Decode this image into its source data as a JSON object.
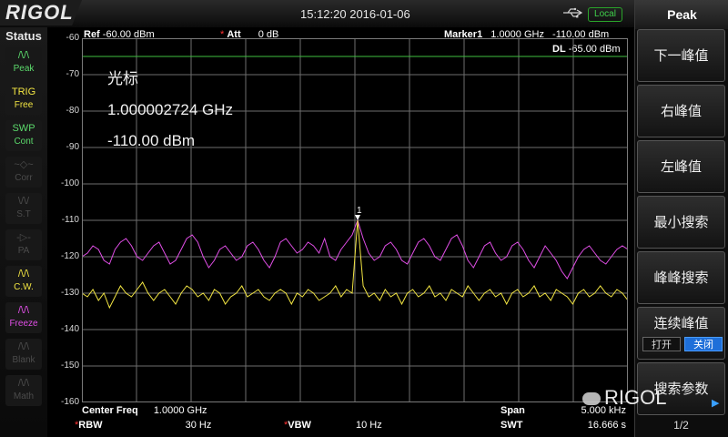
{
  "header": {
    "logo": "RIGOL",
    "datetime": "15:12:20 2016-01-06",
    "usb_icon": "usb-icon",
    "local_badge": "Local"
  },
  "status": {
    "title": "Status",
    "items": [
      {
        "glyph": "/\\/\\",
        "label": "Peak",
        "color": "#5bd96b"
      },
      {
        "glyph": "TRIG",
        "label": "Free",
        "color": "#f2e542"
      },
      {
        "glyph": "SWP",
        "label": "Cont",
        "color": "#5bd96b"
      },
      {
        "glyph": "~◇~",
        "label": "Corr",
        "color": "#4b4b4b"
      },
      {
        "glyph": "\\/\\/",
        "label": "S.T",
        "color": "#4b4b4b"
      },
      {
        "glyph": "-▷-",
        "label": "PA",
        "color": "#4b4b4b"
      },
      {
        "glyph": "/\\/\\",
        "label": "C.W.",
        "color": "#f2e542"
      },
      {
        "glyph": "/\\/\\",
        "label": "Freeze",
        "color": "#e04ee6"
      },
      {
        "glyph": "/\\/\\",
        "label": "Blank",
        "color": "#4b4b4b"
      },
      {
        "glyph": "/\\/\\",
        "label": "Math",
        "color": "#4b4b4b"
      }
    ]
  },
  "top_readouts": {
    "ref_label": "Ref",
    "ref_value": "-60.00 dBm",
    "att_label": "Att",
    "att_value": "0 dB",
    "marker_label": "Marker1",
    "marker_freq": "1.0000 GHz",
    "marker_amp": "-110.00 dBm",
    "dl_label": "DL",
    "dl_value": "-65.00 dBm"
  },
  "marker_box": {
    "title": "光标",
    "freq": "1.000002724 GHz",
    "amp": "-110.00 dBm",
    "marker_number": "1"
  },
  "bottom": {
    "center_label": "Center Freq",
    "center_value": "1.0000 GHz",
    "span_label": "Span",
    "span_value": "5.000 kHz",
    "rbw_label": "RBW",
    "rbw_value": "30 Hz",
    "vbw_label": "VBW",
    "vbw_value": "10 Hz",
    "swt_label": "SWT",
    "swt_value": "16.666 s"
  },
  "menu": {
    "title": "Peak",
    "keys": [
      "下一峰值",
      "右峰值",
      "左峰值",
      "最小搜索",
      "峰峰搜索",
      "连续峰值",
      "搜索参数"
    ],
    "toggle_on": "打开",
    "toggle_off": "关闭",
    "toggle_selected": "关闭",
    "page": "1/2"
  },
  "watermark": "RIGOL",
  "chart_data": {
    "type": "line",
    "ylim": [
      -160,
      -60
    ],
    "y_ticks": [
      "-60",
      "-70",
      "-80",
      "-90",
      "-100",
      "-110",
      "-120",
      "-130",
      "-140",
      "-150",
      "-160"
    ],
    "y_unit": "dBm",
    "display_line": -65,
    "x_center_ghz": 1.0,
    "x_span_khz": 5.0,
    "x_divisions": 10,
    "grid": true,
    "colors": {
      "trace1": "#f2e542",
      "trace2": "#e04ee6",
      "display_line": "#3fbf3f",
      "grid": "#6e6e6e"
    },
    "marker": {
      "number": "1",
      "x_frac": 0.505,
      "y_dbm": -110.0
    },
    "series": [
      {
        "color": "#f2e542",
        "values": [
          -130,
          -131,
          -129,
          -132,
          -130,
          -134,
          -131,
          -128,
          -130,
          -131,
          -129,
          -127,
          -130,
          -132,
          -130,
          -129,
          -131,
          -133,
          -130,
          -128,
          -129,
          -131,
          -130,
          -132,
          -129,
          -130,
          -133,
          -131,
          -130,
          -128,
          -131,
          -130,
          -129,
          -131,
          -132,
          -130,
          -129,
          -130,
          -133,
          -130,
          -131,
          -129,
          -130,
          -132,
          -131,
          -130,
          -128,
          -131,
          -129,
          -130,
          -110,
          -128,
          -131,
          -130,
          -132,
          -129,
          -131,
          -130,
          -133,
          -130,
          -129,
          -131,
          -130,
          -128,
          -131,
          -130,
          -132,
          -129,
          -130,
          -131,
          -128,
          -130,
          -132,
          -130,
          -129,
          -131,
          -130,
          -133,
          -130,
          -129,
          -131,
          -130,
          -128,
          -131,
          -130,
          -132,
          -129,
          -130,
          -131,
          -133,
          -130,
          -129,
          -131,
          -130,
          -128,
          -130,
          -131,
          -129,
          -130,
          -132
        ]
      },
      {
        "color": "#e04ee6",
        "values": [
          -120,
          -119,
          -117,
          -118,
          -121,
          -122,
          -118,
          -116,
          -115,
          -117,
          -120,
          -121,
          -119,
          -117,
          -116,
          -119,
          -122,
          -121,
          -118,
          -115,
          -114,
          -116,
          -120,
          -123,
          -121,
          -118,
          -117,
          -119,
          -121,
          -120,
          -117,
          -116,
          -118,
          -121,
          -123,
          -120,
          -116,
          -115,
          -117,
          -119,
          -118,
          -116,
          -117,
          -119,
          -115,
          -120,
          -121,
          -118,
          -116,
          -114,
          -110,
          -115,
          -119,
          -121,
          -120,
          -117,
          -116,
          -118,
          -121,
          -122,
          -119,
          -116,
          -115,
          -117,
          -120,
          -121,
          -118,
          -115,
          -114,
          -117,
          -121,
          -123,
          -120,
          -117,
          -116,
          -119,
          -121,
          -120,
          -117,
          -116,
          -118,
          -121,
          -123,
          -120,
          -117,
          -119,
          -121,
          -124,
          -126,
          -123,
          -120,
          -118,
          -117,
          -119,
          -121,
          -122,
          -120,
          -118,
          -117,
          -118
        ]
      }
    ]
  }
}
